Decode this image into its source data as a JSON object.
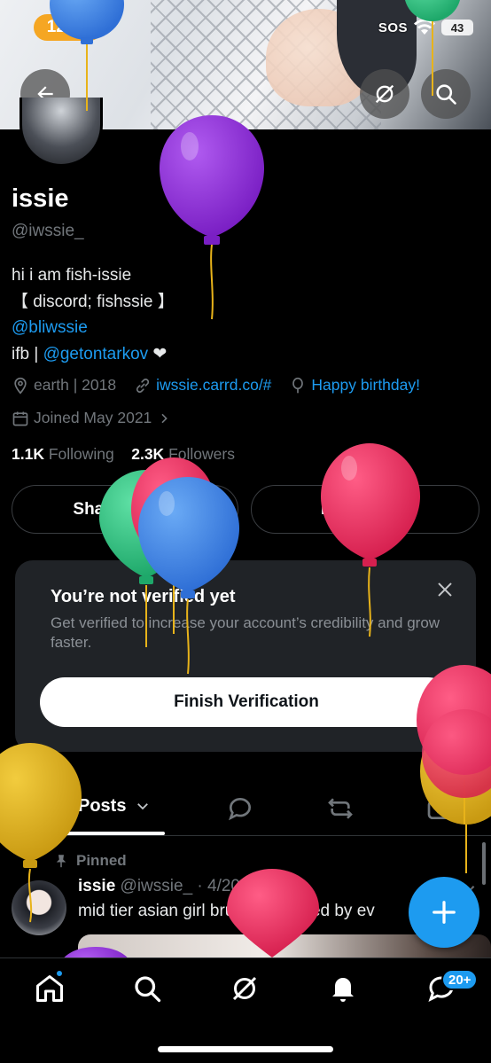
{
  "status_bar": {
    "time": "12:02",
    "sos": "SOS",
    "battery": "43"
  },
  "header": {
    "back_icon": "arrow-left-icon",
    "grok_icon": "grok-icon",
    "search_icon": "search-icon"
  },
  "profile": {
    "name": "issie",
    "handle": "@iwssie_",
    "bio_line1": "hi i am fish-issie",
    "bio_line2": "【 discord; fishssie 】",
    "bio_link1": "@bliwssie",
    "bio_prefix": "ifb | ",
    "bio_link2": "@getontarkov",
    "bio_heart": "❤",
    "location": "earth | 2018",
    "website": "iwssie.carrd.co/#",
    "birthday": "Happy birthday!",
    "joined": "Joined May 2021",
    "following_count": "1.1K",
    "following_label": "Following",
    "followers_count": "2.3K",
    "followers_label": "Followers",
    "share_button": "Share Profile",
    "edit_button": "Edit Profile"
  },
  "verify_card": {
    "title": "You’re not verified yet",
    "text": "Get verified to increase your account’s credibility and grow faster.",
    "button": "Finish Verification"
  },
  "tabs": {
    "posts_label": "Posts"
  },
  "post": {
    "pinned_label": "Pinned",
    "author": "issie",
    "meta": "@iwssie_ · 4/20/26",
    "text": "mid tier asian girl brutally mogged by ev"
  },
  "bottom_nav": {
    "messages_badge": "20+"
  },
  "colors": {
    "accent": "#1d9bf0",
    "background": "#000000",
    "card": "#202327",
    "muted": "#71767b"
  }
}
